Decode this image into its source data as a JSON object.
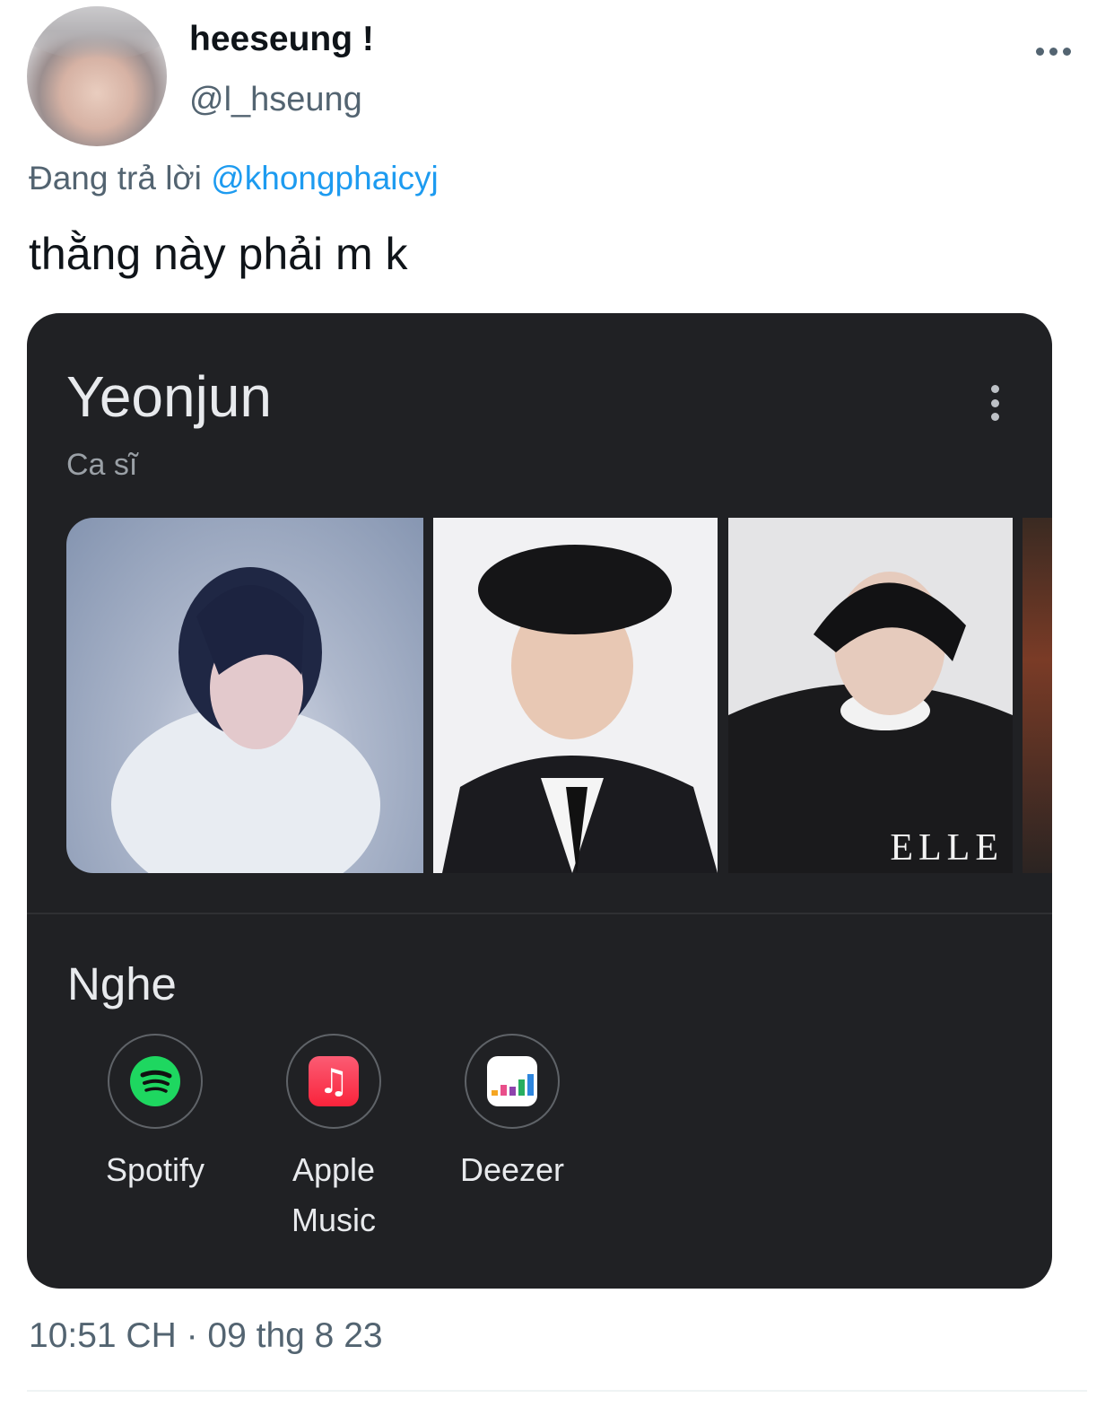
{
  "tweet": {
    "author_name": "heeseung !",
    "author_handle": "@l_hseung",
    "reply_prefix": "Đang trả lời",
    "reply_to": "@khongphaicyj",
    "text": "thằng này phải m k",
    "timestamp": "10:51 CH · 09 thg 8 23",
    "more_icon": "more-horizontal-icon"
  },
  "card": {
    "title": "Yeonjun",
    "subtitle": "Ca sĩ",
    "menu_icon": "more-vertical-icon",
    "photos": [
      {
        "name": "photo-1"
      },
      {
        "name": "photo-2"
      },
      {
        "name": "photo-3",
        "watermark": "ELLE"
      },
      {
        "name": "photo-4"
      }
    ],
    "listen": {
      "heading": "Nghe",
      "services": [
        {
          "label": "Spotify",
          "icon": "spotify-icon"
        },
        {
          "label": "Apple Music",
          "icon": "apple-music-icon"
        },
        {
          "label": "Deezer",
          "icon": "deezer-icon"
        }
      ]
    }
  },
  "colors": {
    "link": "#1d9bf0",
    "card_bg": "#202124",
    "spotify": "#1ed760",
    "apple_music": "#fa233b"
  }
}
